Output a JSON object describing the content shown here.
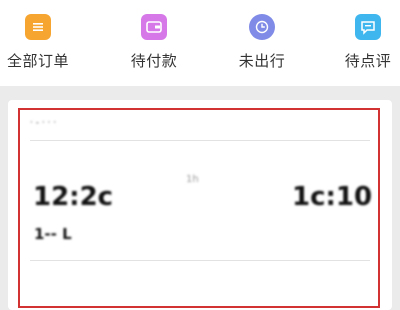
{
  "nav": {
    "items": [
      {
        "label": "全部订单",
        "icon": "list-icon",
        "color": "#f7a531"
      },
      {
        "label": "待付款",
        "icon": "wallet-icon",
        "color": "#d678e8"
      },
      {
        "label": "未出行",
        "icon": "clock-icon",
        "color": "#7f8be6"
      },
      {
        "label": "待点评",
        "icon": "comment-icon",
        "color": "#3fb7ee"
      }
    ]
  },
  "order": {
    "status": "·  -  · ·  ·",
    "dep_date": "",
    "dep_time": "12:2c",
    "dep_station": "1-- L",
    "duration": "1h",
    "arr_date": "",
    "arr_time": "1c:10",
    "arr_station": "",
    "info_1": "",
    "info_2": "",
    "info_3": ""
  },
  "colors": {
    "accent": "#d23232"
  }
}
